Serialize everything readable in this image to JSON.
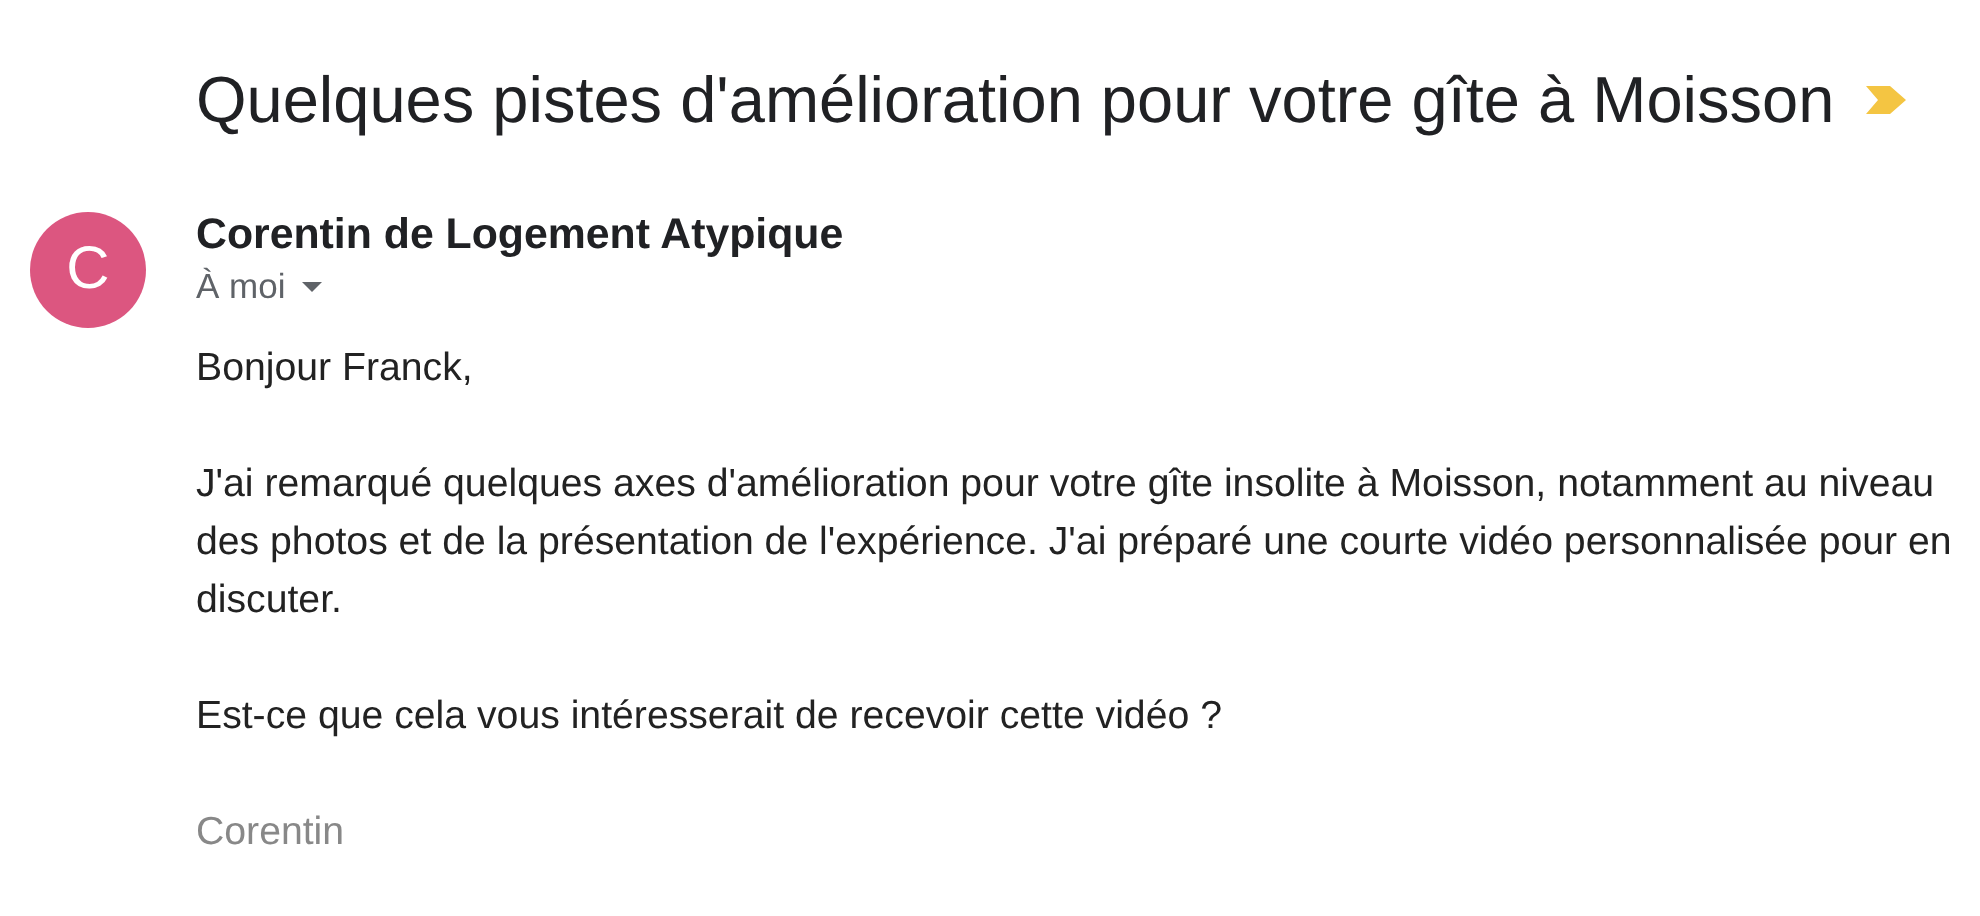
{
  "subject": "Quelques pistes d'amélioration pour votre gîte à Moisson",
  "sender": {
    "avatar_letter": "C",
    "name": "Corentin de Logement Atypique",
    "recipient": "À moi"
  },
  "body": [
    "Bonjour Franck,",
    "J'ai remarqué quelques axes d'amélioration pour votre gîte insolite à Moisson, notamment au niveau des photos et de la présentation de l'expérience. J'ai préparé une courte vidéo personnalisée pour en discuter.",
    "Est-ce que cela vous intéresserait de recevoir cette vidéo ?"
  ],
  "signature": "Corentin"
}
